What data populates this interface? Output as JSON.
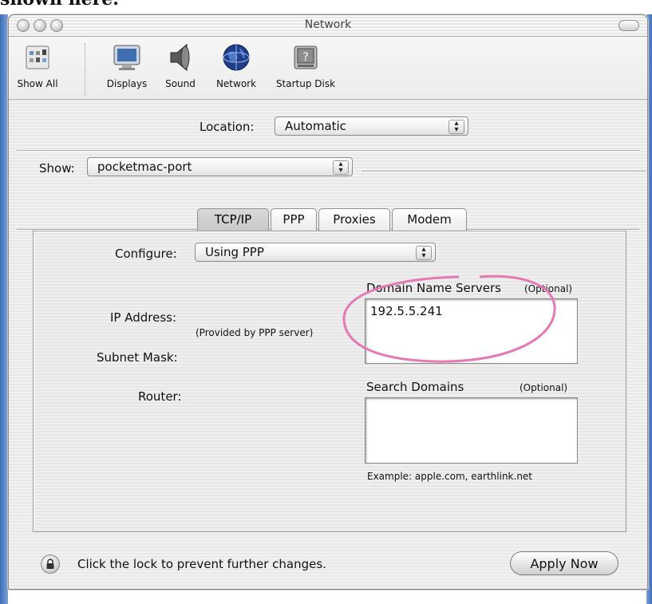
{
  "caption": "shown here.",
  "window": {
    "title": "Network"
  },
  "toolbar": {
    "items": [
      {
        "label": "Show All",
        "icon": "show-all-icon"
      },
      {
        "label": "Displays",
        "icon": "displays-icon"
      },
      {
        "label": "Sound",
        "icon": "sound-icon"
      },
      {
        "label": "Network",
        "icon": "network-globe-icon"
      },
      {
        "label": "Startup Disk",
        "icon": "startup-disk-icon"
      }
    ]
  },
  "location": {
    "label": "Location:",
    "value": "Automatic"
  },
  "show": {
    "label": "Show:",
    "value": "pocketmac-port"
  },
  "tabs": [
    {
      "label": "TCP/IP",
      "active": true
    },
    {
      "label": "PPP",
      "active": false
    },
    {
      "label": "Proxies",
      "active": false
    },
    {
      "label": "Modem",
      "active": false
    }
  ],
  "tcpip": {
    "configure_label": "Configure:",
    "configure_value": "Using PPP",
    "ip_label": "IP Address:",
    "ip_hint": "(Provided by PPP server)",
    "subnet_label": "Subnet Mask:",
    "router_label": "Router:",
    "dns_title": "Domain Name Servers",
    "dns_optional": "(Optional)",
    "dns_value": "192.5.5.241",
    "search_title": "Search Domains",
    "search_optional": "(Optional)",
    "search_value": "",
    "search_example": "Example: apple.com, earthlink.net"
  },
  "footer": {
    "lock_text": "Click the lock to prevent further changes.",
    "apply_label": "Apply Now"
  },
  "colors": {
    "annotation_circle": "#e678b4",
    "desktop_blue": "#4a7cc3"
  }
}
